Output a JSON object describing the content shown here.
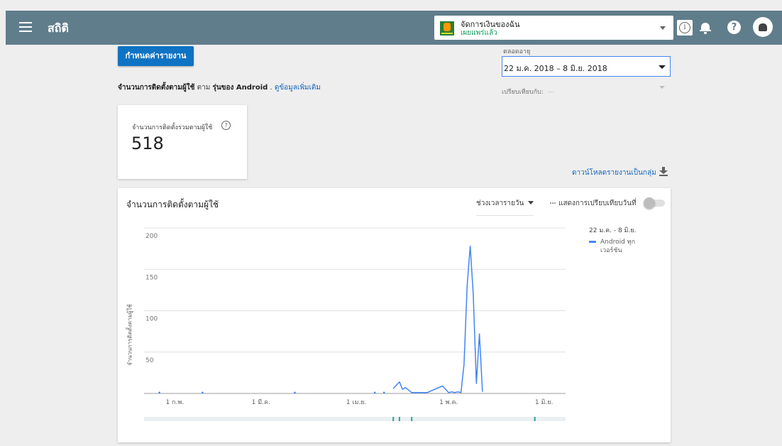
{
  "header": {
    "page_title": "สถิติ",
    "app_name": "จัดการเงินของฉัน",
    "app_status": "เผยแพร่แล้ว",
    "info_glyph": "i",
    "help_glyph": "?"
  },
  "controls": {
    "report_button": "กำหนดค่ารายงาน",
    "metric_strong": "จำนวนการติดตั้งตามผู้ใช้",
    "metric_by": " ตาม ",
    "metric_dim": "รุ่นของ Android",
    "metric_sep": " . ",
    "metric_link": "ดูข้อมูลเพิ่มเติม",
    "range_label": "ตลอดอายุ",
    "range_value": "22 ม.ค. 2018 – 8 มิ.ย. 2018",
    "compare_label": "เปรียบเทียบกับ:",
    "compare_value": "—"
  },
  "kpi": {
    "label": "จำนวนการติดตั้งรวมตามผู้ใช้",
    "help_glyph": "?",
    "value": "518"
  },
  "download_label": "ดาวน์โหลดรายงานเป็นกลุ่ม",
  "chart": {
    "title": "จำนวนการติดตั้งตามผู้ใช้",
    "interval_label": "ช่วงเวลารายวัน",
    "compare_toggle_label": "แสดงการเปรียบเทียบวันที่",
    "legend_range": "22 ม.ค. - 8 มิ.ย.",
    "legend_series": "Android ทุกเวอร์ชัน",
    "series_color": "#4285f4"
  },
  "chart_data": {
    "type": "line",
    "title": "จำนวนการติดตั้งตามผู้ใช้",
    "xlabel": "",
    "ylabel": "จำนวนการติดตั้งตามผู้ใช้",
    "ylim": [
      0,
      200
    ],
    "yticks": [
      50,
      100,
      150,
      200
    ],
    "xticks": [
      "1 ก.พ.",
      "1 มี.ค.",
      "1 เม.ย.",
      "1 พ.ค.",
      "1 มิ.ย."
    ],
    "xtick_days": [
      10,
      38,
      69,
      99,
      130
    ],
    "x_range_days": [
      0,
      137
    ],
    "grid": true,
    "series": [
      {
        "name": "Android ทุกเวอร์ชัน",
        "points": [
          [
            5,
            1
          ],
          [
            19,
            1
          ],
          [
            49,
            1
          ],
          [
            75,
            1
          ],
          [
            78,
            1
          ],
          [
            81,
            6
          ],
          [
            83,
            14
          ],
          [
            84,
            5
          ],
          [
            85,
            7
          ],
          [
            87,
            1
          ],
          [
            92,
            1
          ],
          [
            97,
            9
          ],
          [
            99,
            1
          ],
          [
            100,
            2
          ],
          [
            101,
            1
          ],
          [
            102,
            2
          ],
          [
            103,
            1
          ],
          [
            104,
            35
          ],
          [
            105,
            130
          ],
          [
            106,
            178
          ],
          [
            107,
            120
          ],
          [
            108,
            12
          ],
          [
            109,
            72
          ],
          [
            110,
            2
          ]
        ]
      }
    ],
    "highlight_ticks_days": [
      81,
      83,
      87,
      127
    ]
  }
}
